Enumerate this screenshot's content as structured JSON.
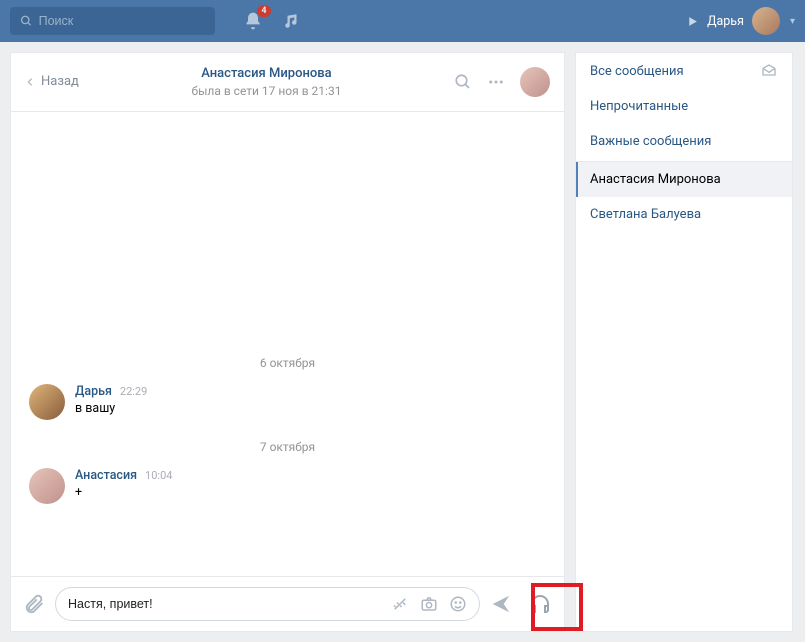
{
  "topbar": {
    "search_placeholder": "Поиск",
    "notifications_count": "4",
    "user_name": "Дарья"
  },
  "chat": {
    "back_label": "Назад",
    "title": "Анастасия Миронова",
    "status": "была в сети 17 ноя в 21:31"
  },
  "dates": {
    "d1": "6 октября",
    "d2": "7 октября"
  },
  "messages": {
    "m1": {
      "author": "Дарья",
      "time": "22:29",
      "text": "в вашу"
    },
    "m2": {
      "author": "Анастасия",
      "time": "10:04",
      "text": "+"
    }
  },
  "composer": {
    "value": "Настя, привет!"
  },
  "sidebar": {
    "all": "Все сообщения",
    "unread": "Непрочитанные",
    "important": "Важные сообщения",
    "contacts": {
      "c1": "Анастасия Миронова",
      "c2": "Светлана Балуева"
    }
  }
}
